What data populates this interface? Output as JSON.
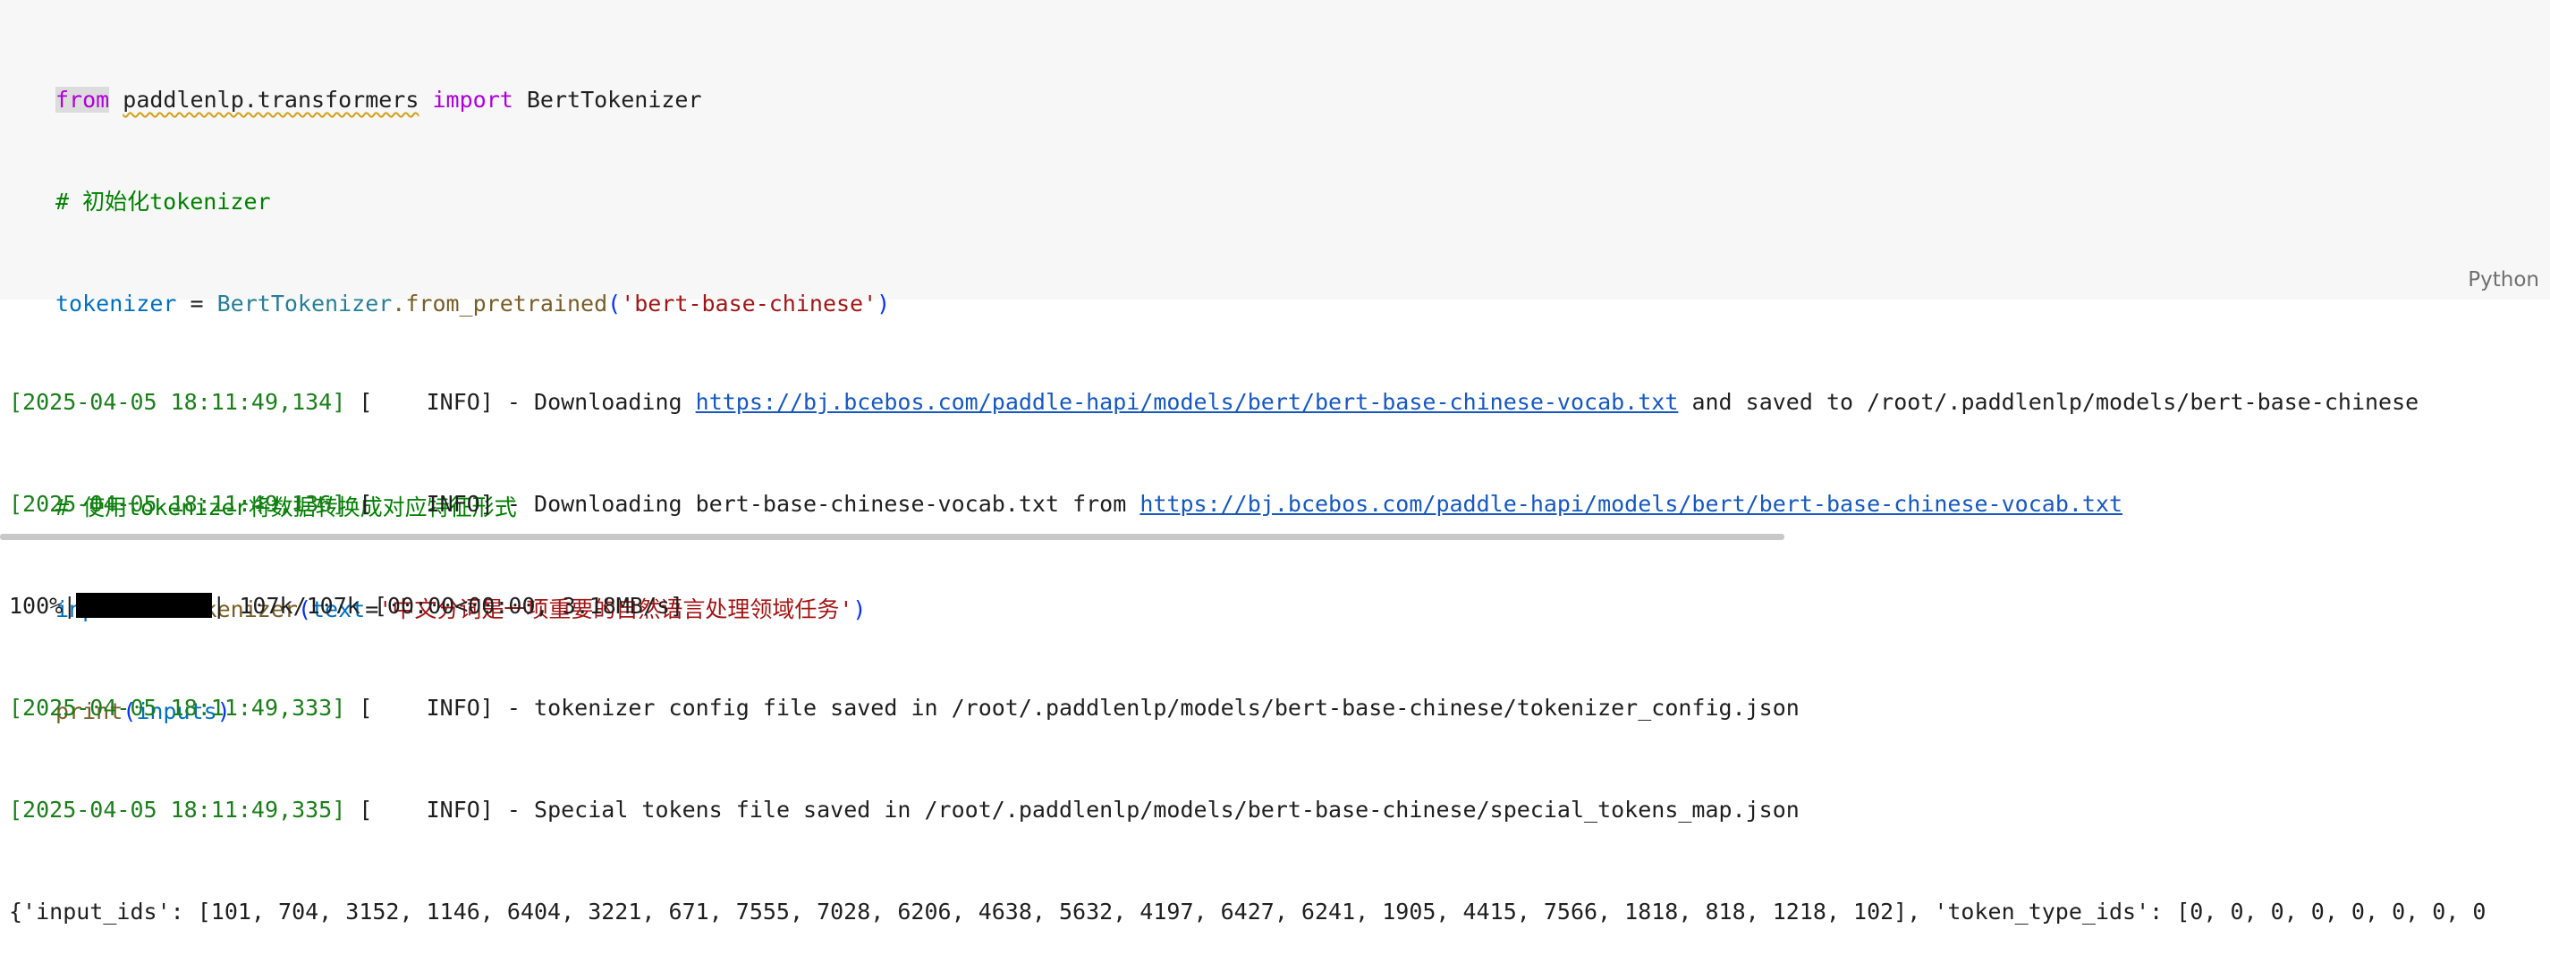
{
  "code": {
    "l1_from": "from",
    "l1_module": "paddlenlp.transformers",
    "l1_import": "import",
    "l1_class": "BertTokenizer",
    "l2_comment": "# 初始化tokenizer",
    "l3_var": "tokenizer",
    "l3_eq": " = ",
    "l3_class": "BertTokenizer",
    "l3_method": ".from_pretrained",
    "l3_lparen": "(",
    "l3_str": "'bert-base-chinese'",
    "l3_rparen": ")",
    "l5_comment": "# 使用tokenizer将数据转换成对应特征形式",
    "l6_var": "inputs",
    "l6_eq": " = ",
    "l6_fn": "tokenizer",
    "l6_lparen": "(",
    "l6_kwarg": "text",
    "l6_assign": "=",
    "l6_str": "'中文分词是一项重要的自然语言处理领域任务'",
    "l6_rparen": ")",
    "l7_fn": "print",
    "l7_lparen": "(",
    "l7_arg": "inputs",
    "l7_rparen": ")"
  },
  "cell_language": "Python",
  "output": {
    "line1": {
      "ts": "[2025-04-05 18:11:49,134]",
      "level": " [    INFO] - Downloading ",
      "url": "https://bj.bcebos.com/paddle-hapi/models/bert/bert-base-chinese-vocab.txt",
      "rest": " and saved to /root/.paddlenlp/models/bert-base-chinese"
    },
    "line2": {
      "ts": "[2025-04-05 18:11:49,136]",
      "level": " [    INFO] - Downloading bert-base-chinese-vocab.txt from ",
      "url": "https://bj.bcebos.com/paddle-hapi/models/bert/bert-base-chinese-vocab.txt"
    },
    "progress": {
      "percent": "100%|",
      "fraction": 1.0,
      "rest": "| 107k/107k [00:00<00:00, 3.18MB/s]"
    },
    "line4": {
      "ts": "[2025-04-05 18:11:49,333]",
      "rest": " [    INFO] - tokenizer config file saved in /root/.paddlenlp/models/bert-base-chinese/tokenizer_config.json"
    },
    "line5": {
      "ts": "[2025-04-05 18:11:49,335]",
      "rest": " [    INFO] - Special tokens file saved in /root/.paddlenlp/models/bert-base-chinese/special_tokens_map.json"
    },
    "result": "{'input_ids': [101, 704, 3152, 1146, 6404, 3221, 671, 7555, 7028, 6206, 4638, 5632, 4197, 6427, 6241, 1905, 4415, 7566, 1818, 818, 1218, 102], 'token_type_ids': [0, 0, 0, 0, 0, 0, 0, 0"
  }
}
